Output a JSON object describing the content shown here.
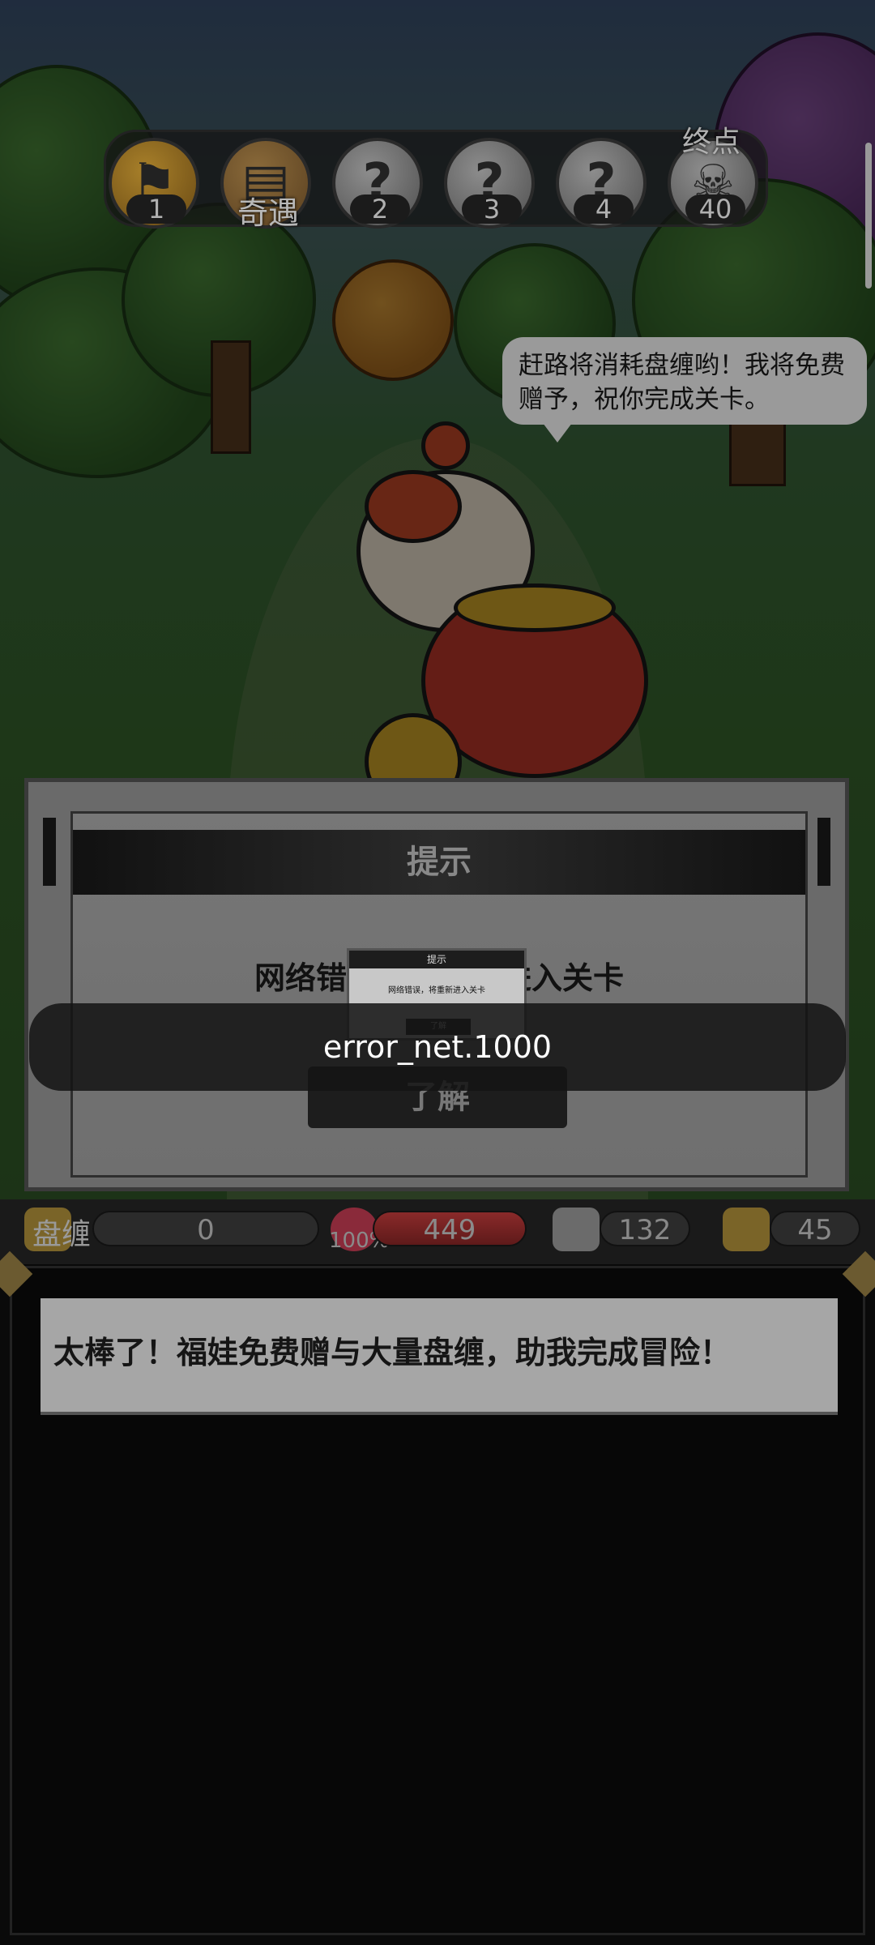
{
  "progress": {
    "nodes": [
      {
        "label": "1",
        "kind": "flag-icon"
      },
      {
        "label": "奇遇",
        "kind": "book-icon"
      },
      {
        "label": "2",
        "kind": "question-icon"
      },
      {
        "label": "3",
        "kind": "question-icon"
      },
      {
        "label": "4",
        "kind": "question-icon"
      },
      {
        "label": "40",
        "kind": "skull-icon"
      }
    ],
    "end_label": "终点",
    "question_glyph": "?"
  },
  "npc": {
    "speech": "赶路将消耗盘缠哟！我将免费赠予，祝你完成关卡。"
  },
  "dialog": {
    "title": "提示",
    "message": "网络错误，将重新进入关卡",
    "confirm": "了解",
    "mini_title": "提示",
    "mini_message": "网络错误，将重新进入关卡",
    "mini_confirm": "了解"
  },
  "toast": {
    "text": "error_net.1000"
  },
  "stats": {
    "money_label": "盘缠",
    "money": "0",
    "hp_pct": "100%",
    "hp": "449",
    "attack": "132",
    "defense": "45"
  },
  "log": {
    "line": "太棒了！福娃免费赠与大量盘缠，助我完成冒险！"
  },
  "colors": {
    "accent_gold": "#c89a2a",
    "hp_red": "#8a2a2a"
  }
}
